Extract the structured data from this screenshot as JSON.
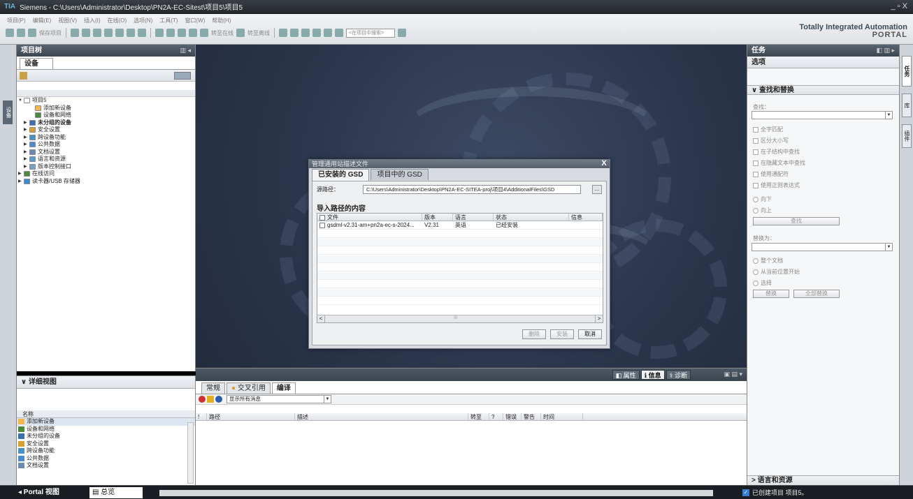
{
  "window": {
    "logo": "TIA",
    "title": "Siemens  -  C:\\Users\\Administrator\\Desktop\\PN2A-EC-Sitest\\项目5\\项目5",
    "controls": "_ ▫ X"
  },
  "menu": [
    "项目(P)",
    "编辑(E)",
    "视图(V)",
    "插入(I)",
    "在线(O)",
    "选项(N)",
    "工具(T)",
    "窗口(W)",
    "帮助(H)"
  ],
  "toolbar": {
    "save_label": "保存项目",
    "go_online": "转至在线",
    "go_offline": "转至离线",
    "search_placeholder": "<在项目中搜索>"
  },
  "brand": {
    "line1": "Totally Integrated Automation",
    "line2": "PORTAL"
  },
  "project_tree": {
    "header": "项目树",
    "tab": "设备",
    "side_tab": "设备",
    "items": [
      {
        "label": "项目5",
        "arrow": "▼",
        "color": "#ffffff",
        "bold": false,
        "indent": 0
      },
      {
        "label": "添加新设备",
        "arrow": "",
        "color": "#f2b84b",
        "bold": false,
        "indent": 2
      },
      {
        "label": "设备和网络",
        "arrow": "",
        "color": "#4a8a3a",
        "bold": false,
        "indent": 2
      },
      {
        "label": "未分组的设备",
        "arrow": "▶",
        "color": "#3a6fb0",
        "bold": true,
        "indent": 1
      },
      {
        "label": "安全设置",
        "arrow": "▶",
        "color": "#d9a030",
        "bold": false,
        "indent": 1
      },
      {
        "label": "跨设备功能",
        "arrow": "▶",
        "color": "#4a90c8",
        "bold": false,
        "indent": 1
      },
      {
        "label": "公共数据",
        "arrow": "▶",
        "color": "#4a8ad0",
        "bold": false,
        "indent": 1
      },
      {
        "label": "文档设置",
        "arrow": "▶",
        "color": "#6a8cb0",
        "bold": false,
        "indent": 1
      },
      {
        "label": "语言和资源",
        "arrow": "▶",
        "color": "#5a9ad0",
        "bold": false,
        "indent": 1
      },
      {
        "label": "版本控制接口",
        "arrow": "▶",
        "color": "#7aa0c0",
        "bold": false,
        "indent": 1
      },
      {
        "label": "在线访问",
        "arrow": "▶",
        "color": "#4a8a3a",
        "bold": false,
        "indent": 0
      },
      {
        "label": "读卡器/USB 存储器",
        "arrow": "▶",
        "color": "#3a8ad0",
        "bold": false,
        "indent": 0
      }
    ]
  },
  "detail_view": {
    "header": "详细视图",
    "column": "名称",
    "items": [
      {
        "label": "添加新设备",
        "color": "#f2b84b",
        "selected": true
      },
      {
        "label": "设备和网络",
        "color": "#4a8a3a",
        "selected": false
      },
      {
        "label": "未分组的设备",
        "color": "#3a6fb0",
        "selected": false
      },
      {
        "label": "安全设置",
        "color": "#d9a030",
        "selected": false
      },
      {
        "label": "跨设备功能",
        "color": "#4a90c8",
        "selected": false
      },
      {
        "label": "公共数据",
        "color": "#4a8ad0",
        "selected": false
      },
      {
        "label": "文档设置",
        "color": "#6a8cb0",
        "selected": false
      }
    ]
  },
  "dialog": {
    "title": "管理通用站描述文件",
    "close": "X",
    "tabs": [
      {
        "label": "已安装的 GSD",
        "active": true
      },
      {
        "label": "项目中的 GSD",
        "active": false
      }
    ],
    "source_label": "源路径：",
    "source_path": "C:\\Users\\Administrator\\Desktop\\PN2A-EC-SITEA-proj\\项目4\\AdditionalFiles\\GSD",
    "browse": "...",
    "import_label": "导入路径的内容",
    "columns": [
      "文件",
      "版本",
      "语言",
      "状态",
      "信息"
    ],
    "rows": [
      {
        "file": "gsdml-v2.31-am+pn2a-ec-s-2024...",
        "version": "V2.31",
        "language": "英语",
        "status": "已经安装",
        "info": ""
      }
    ],
    "scroll_left": "<",
    "scroll_mid": "III",
    "scroll_right": ">",
    "buttons": {
      "delete": "删除",
      "install": "安装",
      "cancel": "取消"
    }
  },
  "inspector": {
    "tabs": [
      {
        "label": "属性",
        "active": false
      },
      {
        "label": "信息",
        "active": true
      },
      {
        "label": "诊断",
        "active": false
      }
    ],
    "subtabs": [
      {
        "label": "常规",
        "active": false
      },
      {
        "label": "交叉引用",
        "active": false
      },
      {
        "label": "编译",
        "active": true
      }
    ],
    "filter": "显示所有消息",
    "columns": [
      "!",
      "路径",
      "描述",
      "转至",
      "?",
      "错误",
      "警告",
      "时间"
    ]
  },
  "task_pane": {
    "header": "任务",
    "options": "选项",
    "find_replace": "查找和替换",
    "find_label": "查找：",
    "checkboxes": [
      "全字匹配",
      "区分大小写",
      "在子结构中查找",
      "在隐藏文本中查找",
      "使用通配符",
      "使用正则表达式"
    ],
    "direction": [
      "向下",
      "向上"
    ],
    "find_button": "查找",
    "replace_label": "替换为：",
    "scope": [
      "整个文档",
      "从当前位置开始",
      "选择"
    ],
    "replace_button": "替换",
    "replace_all_button": "全部替换",
    "language_resources": "语言和资源",
    "side_tabs": [
      "任务",
      "库",
      "插件"
    ]
  },
  "statusbar": {
    "portal_view": "◂ Portal 视图",
    "overview": "总览",
    "message": "已创建项目 项目5。"
  }
}
